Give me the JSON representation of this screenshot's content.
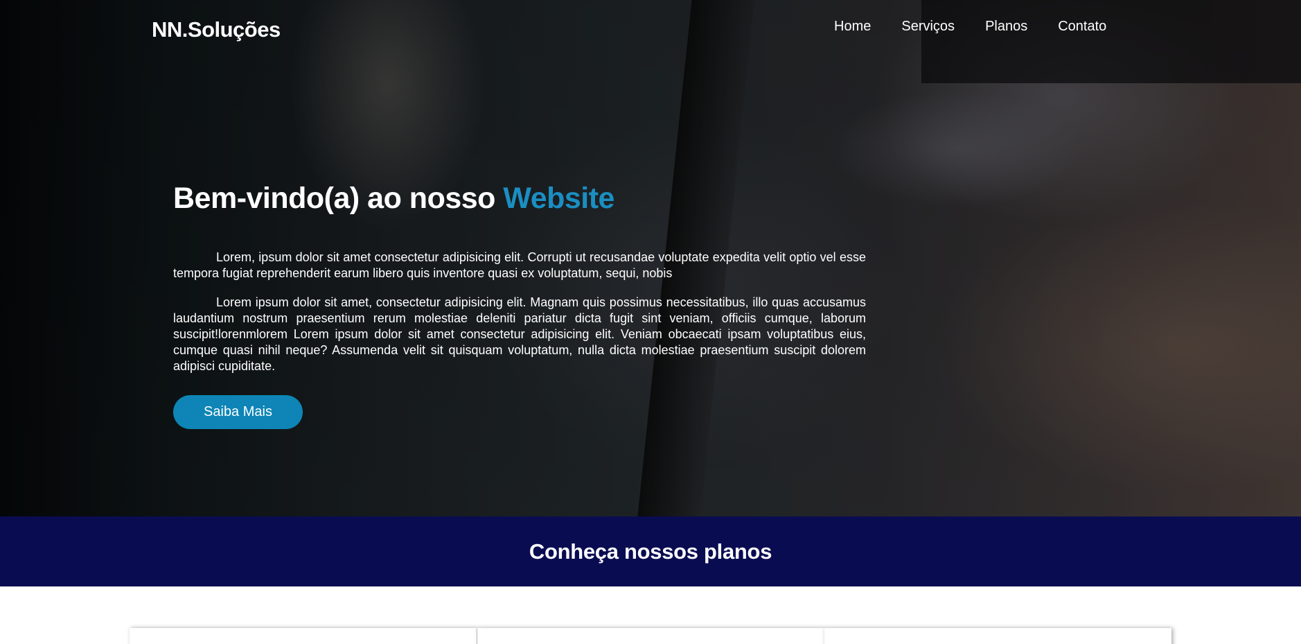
{
  "header": {
    "logo": "NN.Soluções",
    "nav": [
      "Home",
      "Serviços",
      "Planos",
      "Contato"
    ]
  },
  "hero": {
    "title_main": "Bem-vindo(a) ao nosso ",
    "title_accent": "Website",
    "paragraphs": [
      "Lorem, ipsum dolor sit amet consectetur adipisicing elit. Corrupti ut recusandae voluptate expedita velit optio vel esse tempora fugiat reprehenderit earum libero quis inventore quasi ex voluptatum, sequi, nobis",
      "Lorem ipsum dolor sit amet, consectetur adipisicing elit. Magnam quis possimus necessitatibus, illo quas accusamus laudantium nostrum praesentium rerum molestiae deleniti pariatur dicta fugit sint veniam, officiis cumque, laborum suscipit!lorenmlorem Lorem ipsum dolor sit amet consectetur adipisicing elit. Veniam obcaecati ipsam voluptatibus eius, cumque quasi nihil neque? Assumenda velit sit quisquam voluptatum, nulla dicta molestiae praesentium suscipit dolorem adipisci cupiditate."
    ],
    "button_label": "Saiba Mais"
  },
  "plans": {
    "heading": "Conheça nossos planos"
  },
  "colors": {
    "accent": "#1b8ec2",
    "button": "#0e85b6",
    "banner": "#0a0c52"
  }
}
